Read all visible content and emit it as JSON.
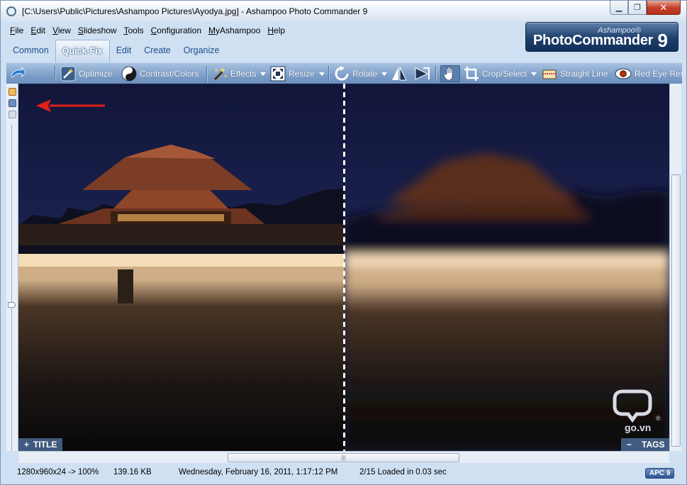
{
  "window": {
    "title": "[C:\\Users\\Public\\Pictures\\Ashampoo Pictures\\Ayodya.jpg] - Ashampoo Photo Commander 9",
    "min_label": "▁",
    "max_label": "❐",
    "close_label": "✕"
  },
  "menu": [
    "File",
    "Edit",
    "View",
    "Slideshow",
    "Tools",
    "Configuration",
    "MyAshampoo",
    "Help"
  ],
  "tabs": [
    {
      "label": "Common",
      "active": false
    },
    {
      "label": "Quick-Fix",
      "active": true
    },
    {
      "label": "Edit",
      "active": false
    },
    {
      "label": "Create",
      "active": false
    },
    {
      "label": "Organize",
      "active": false
    }
  ],
  "brand": {
    "small": "Ashampoo®",
    "big": "PhotoCommander",
    "num": "9"
  },
  "toolbar": {
    "optimize": "Optimize",
    "contrast": "Contrast/Colors",
    "effects": "Effects",
    "resize": "Resize",
    "rotate": "Rotate",
    "crop": "Crop/Select",
    "straight": "Straight Line",
    "redeye": "Red Eye Remo"
  },
  "overlay": {
    "title": "TITLE",
    "tags": "TAGS",
    "title_sign": "+",
    "tags_sign": "−"
  },
  "watermark": {
    "text": "go.vn",
    "reg": "®"
  },
  "status": {
    "dimensions": "1280x960x24 -> 100%",
    "size": "139.16 KB",
    "date": "Wednesday, February 16, 2011, 1:17:12 PM",
    "loaded": "2/15  Loaded in 0.03 sec",
    "badge": "APC 9"
  },
  "colors": {
    "accent": "#1d3e6c",
    "arrow": "#e0201a",
    "toolbar": "#7c9ec8"
  },
  "icons": [
    "app-icon",
    "undo-icon",
    "redo-icon",
    "optimize-wand-icon",
    "contrast-icon",
    "effects-wand-icon",
    "resize-icon",
    "rotate-icon",
    "flip-icon",
    "mirror-icon",
    "hand-icon",
    "crop-icon",
    "straight-line-icon",
    "red-eye-icon"
  ]
}
